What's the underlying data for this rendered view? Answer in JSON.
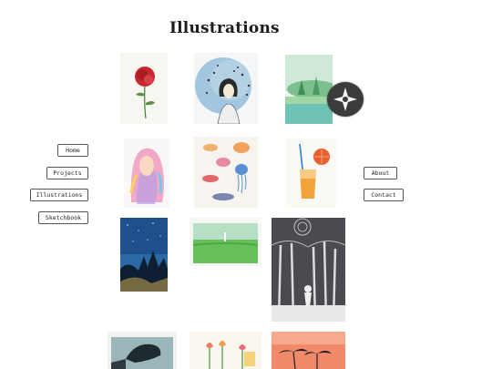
{
  "page": {
    "title": "Illustrations"
  },
  "nav_left": [
    {
      "label": "Home"
    },
    {
      "label": "Projects"
    },
    {
      "label": "Illustrations"
    },
    {
      "label": "Sketchbook"
    }
  ],
  "nav_right": [
    {
      "label": "About"
    },
    {
      "label": "Contact"
    }
  ],
  "gallery": [
    {
      "subject": "red rose"
    },
    {
      "subject": "girl with stars"
    },
    {
      "subject": "green watercolor landscape"
    },
    {
      "subject": "pink haired girl"
    },
    {
      "subject": "fish and jellyfish"
    },
    {
      "subject": "orange drink"
    },
    {
      "subject": "night forest"
    },
    {
      "subject": "green field"
    },
    {
      "subject": "black and white forest with figure"
    },
    {
      "subject": "dark shapes"
    },
    {
      "subject": "tulips"
    },
    {
      "subject": "palm trees sunset"
    }
  ],
  "colors": {
    "background": "#ffffff",
    "overlay": "#3b3b3b"
  }
}
